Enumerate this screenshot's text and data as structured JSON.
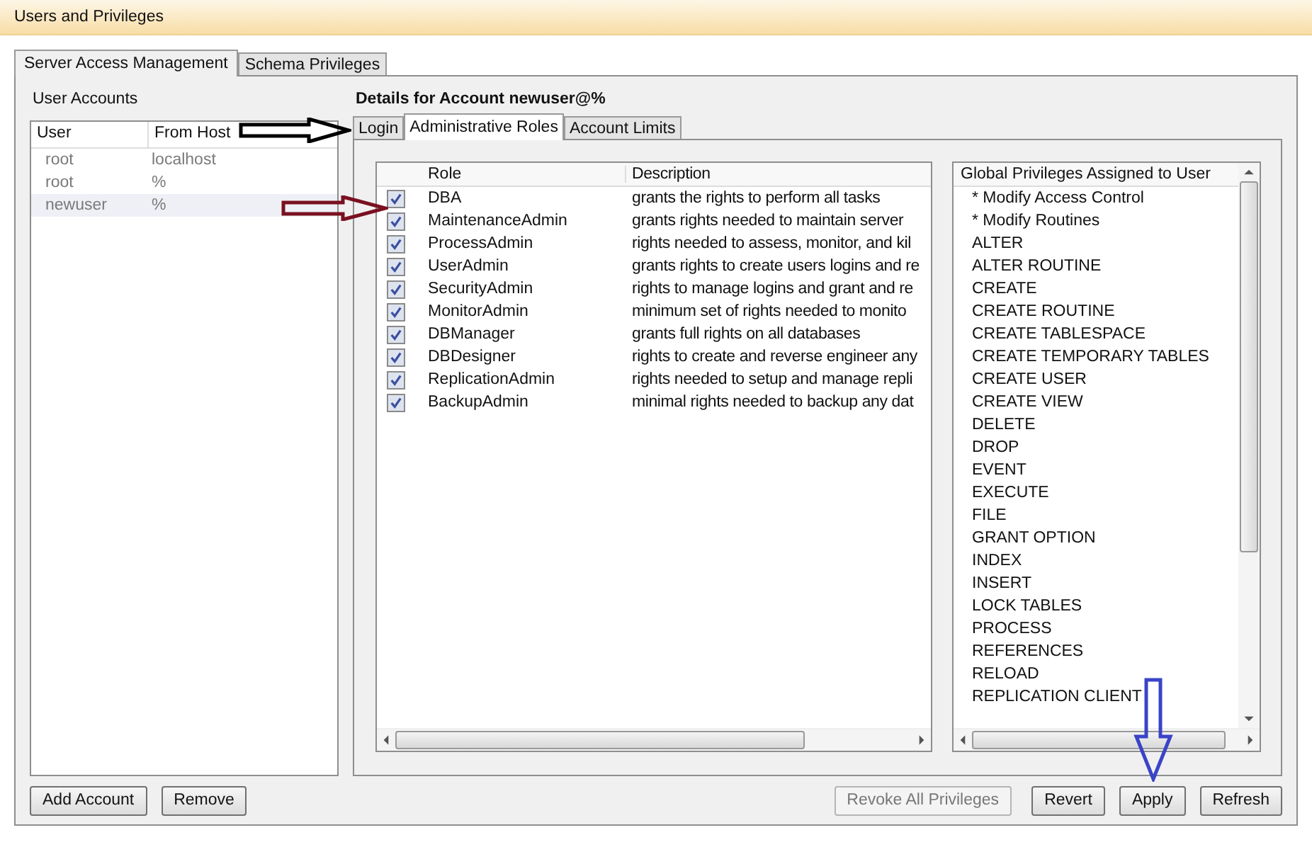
{
  "window": {
    "title": "Users and Privileges"
  },
  "tabs": [
    {
      "label": "Server Access Management",
      "selected": true
    },
    {
      "label": "Schema Privileges",
      "selected": false
    }
  ],
  "user_accounts": {
    "title": "User Accounts",
    "columns": [
      "User",
      "From Host"
    ],
    "rows": [
      {
        "user": "root",
        "host": "localhost",
        "selected": false
      },
      {
        "user": "root",
        "host": "%",
        "selected": false
      },
      {
        "user": "newuser",
        "host": "%",
        "selected": true
      }
    ]
  },
  "details": {
    "title": "Details for Account newuser@%",
    "tabs": [
      {
        "label": "Login",
        "selected": false
      },
      {
        "label": "Administrative Roles",
        "selected": true
      },
      {
        "label": "Account Limits",
        "selected": false
      }
    ],
    "roles": {
      "columns": [
        "Role",
        "Description"
      ],
      "rows": [
        {
          "role": "DBA",
          "description": "grants the rights to perform all tasks",
          "checked": true
        },
        {
          "role": "MaintenanceAdmin",
          "description": "grants rights needed to maintain server",
          "checked": true
        },
        {
          "role": "ProcessAdmin",
          "description": "rights needed to assess, monitor, and kil",
          "checked": true
        },
        {
          "role": "UserAdmin",
          "description": "grants rights to create users logins and re",
          "checked": true
        },
        {
          "role": "SecurityAdmin",
          "description": "rights to manage logins and grant and re",
          "checked": true
        },
        {
          "role": "MonitorAdmin",
          "description": "minimum set of rights needed to monito",
          "checked": true
        },
        {
          "role": "DBManager",
          "description": "grants full rights on all databases",
          "checked": true
        },
        {
          "role": "DBDesigner",
          "description": "rights to create and reverse engineer any",
          "checked": true
        },
        {
          "role": "ReplicationAdmin",
          "description": "rights needed to setup and manage repli",
          "checked": true
        },
        {
          "role": "BackupAdmin",
          "description": "minimal rights needed to backup any dat",
          "checked": true
        }
      ]
    },
    "privileges": {
      "title": "Global Privileges Assigned to User",
      "items": [
        "* Modify Access Control",
        "* Modify Routines",
        "ALTER",
        "ALTER ROUTINE",
        "CREATE",
        "CREATE ROUTINE",
        "CREATE TABLESPACE",
        "CREATE TEMPORARY TABLES",
        "CREATE USER",
        "CREATE VIEW",
        "DELETE",
        "DROP",
        "EVENT",
        "EXECUTE",
        "FILE",
        "GRANT OPTION",
        "INDEX",
        "INSERT",
        "LOCK TABLES",
        "PROCESS",
        "REFERENCES",
        "RELOAD",
        "REPLICATION CLIENT"
      ]
    }
  },
  "left_buttons": [
    {
      "label": "Add Account",
      "disabled": false
    },
    {
      "label": "Remove",
      "disabled": false
    }
  ],
  "right_buttons": [
    {
      "label": "Revoke All Privileges",
      "disabled": true
    },
    {
      "label": "Revert",
      "disabled": false
    },
    {
      "label": "Apply",
      "disabled": false
    },
    {
      "label": "Refresh",
      "disabled": false
    }
  ]
}
